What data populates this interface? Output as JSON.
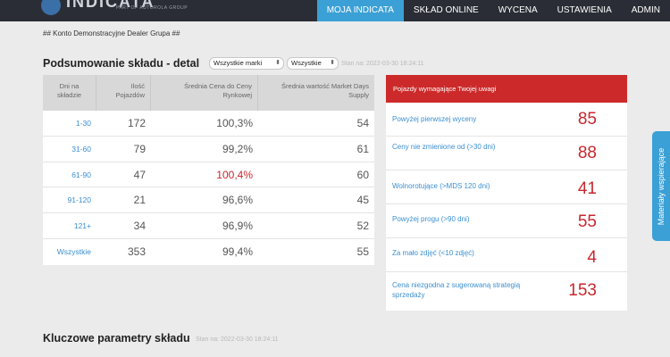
{
  "nav": {
    "logo_text": "INDICATA",
    "logo_sub": "PART OF AUTOROLA GROUP",
    "items": [
      "MOJA INDICATA",
      "SKŁAD ONLINE",
      "WYCENA",
      "USTAWIENIA",
      "ADMIN"
    ],
    "active": "MOJA INDICATA"
  },
  "account": "## Konto Demonstracyjne Dealer Grupa ##",
  "summary": {
    "title": "Podsumowanie składu - detal",
    "filter_brand": "Wszystkie marki",
    "filter_all": "Wszystkie",
    "stamp": "Stan na: 2022-03-30 18:24:11",
    "headers": [
      "Dni na składzie",
      "Ilość Pojazdów",
      "Średnia Cena do Ceny Rynkowej",
      "Średnia wartość Market Days Supply"
    ],
    "rows": [
      {
        "range": "1-30",
        "count": "172",
        "price": "100,3%",
        "mds": "54"
      },
      {
        "range": "31-60",
        "count": "79",
        "price": "99,2%",
        "mds": "61"
      },
      {
        "range": "61-90",
        "count": "47",
        "price": "100,4%",
        "mds": "60"
      },
      {
        "range": "91-120",
        "count": "21",
        "price": "96,6%",
        "mds": "45"
      },
      {
        "range": "121+",
        "count": "34",
        "price": "96,9%",
        "mds": "52"
      },
      {
        "range": "Wszystkie",
        "count": "353",
        "price": "99,4%",
        "mds": "55"
      }
    ],
    "highlight_color": "#c8272d"
  },
  "attention": {
    "title": "Pojazdy wymagające Twojej uwagi",
    "items": [
      {
        "label": "Powyżej pierwszej wyceny",
        "value": "85"
      },
      {
        "label": "Ceny nie zmienione od (>30 dni)",
        "value": "88"
      },
      {
        "label": "Wolnorotujące (>MDS 120 dni)",
        "value": "41"
      },
      {
        "label": "Powyżej progu (>90 dni)",
        "value": "55"
      },
      {
        "label": "Za mało zdjęć (<10 zdjęć)",
        "value": "4"
      },
      {
        "label": "Cena niezgodna z sugerowaną strategią sprzedaży",
        "value": "153"
      }
    ],
    "header_color": "#cc2a2a"
  },
  "key_params": {
    "title": "Kluczowe parametry składu",
    "stamp": "Stan na: 2022-03-30 18:24:11"
  },
  "side_tab": "Materiały wspierające",
  "colors": {
    "accent": "#3ba0d5",
    "nav_bg": "#2a2d35",
    "link": "#3b8fd0"
  }
}
